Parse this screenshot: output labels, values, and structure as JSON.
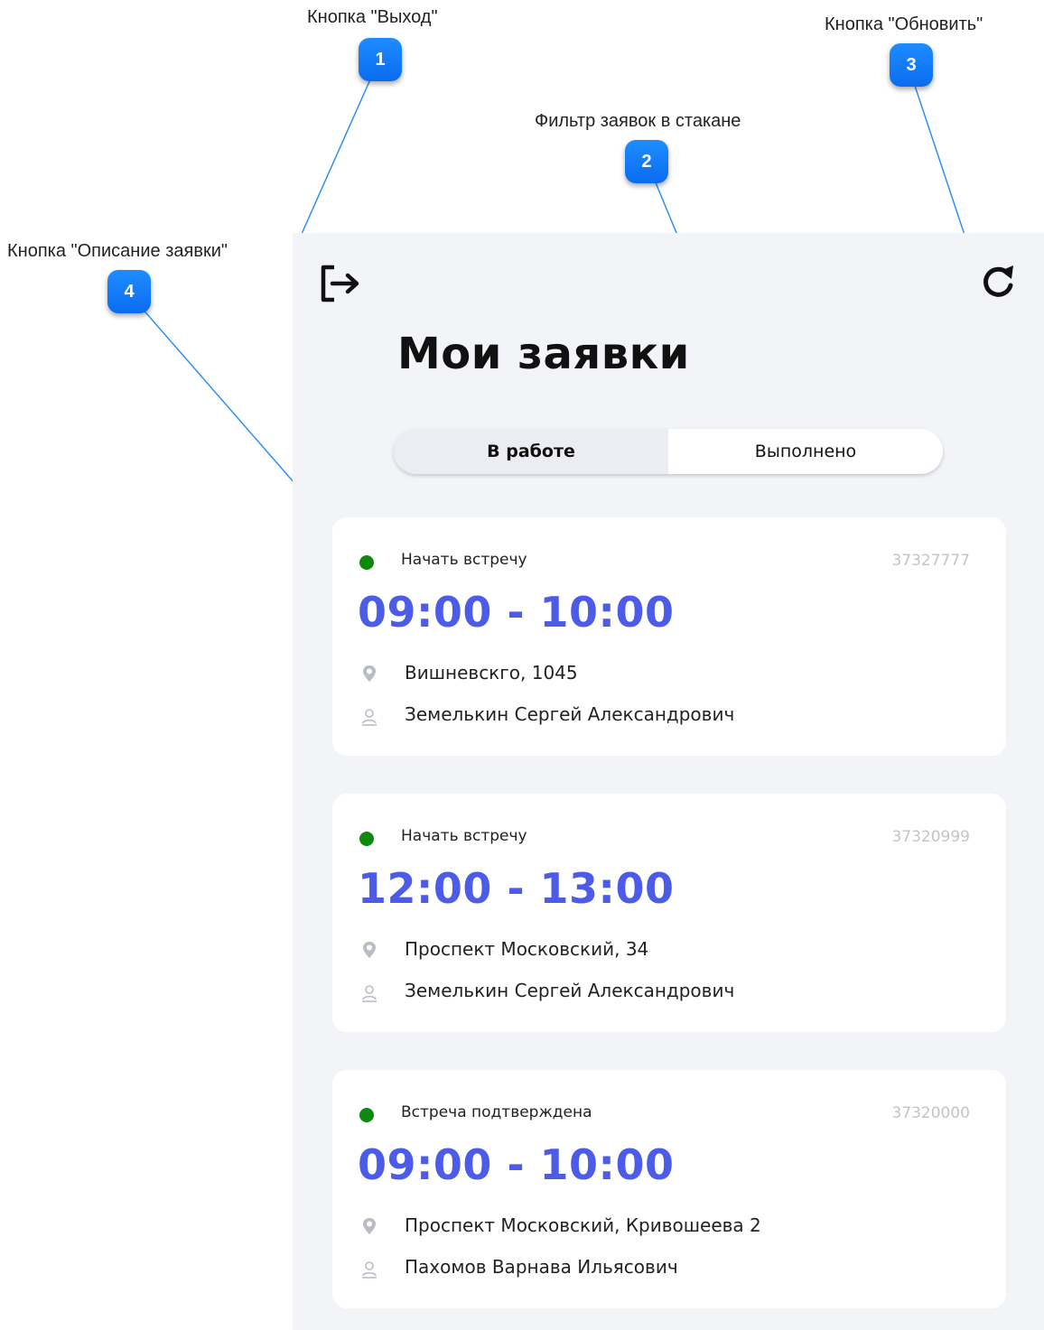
{
  "annotations": [
    {
      "number": "1",
      "label": "Кнопка \"Выход\""
    },
    {
      "number": "2",
      "label": "Фильтр заявок в стакане"
    },
    {
      "number": "3",
      "label": "Кнопка \"Обновить\""
    },
    {
      "number": "4",
      "label": "Кнопка \"Описание заявки\""
    }
  ],
  "header": {
    "exit_icon": "logout-icon",
    "refresh_icon": "refresh-icon",
    "title": "Мои заявки"
  },
  "filter": {
    "tabs": [
      {
        "label": "В работе",
        "active": true
      },
      {
        "label": "Выполнено",
        "active": false
      }
    ]
  },
  "requests": [
    {
      "status": "Начать встречу",
      "status_color": "#0d8a0d",
      "number": "37327777",
      "time": "09:00 - 10:00",
      "address": "Вишневскго, 1045",
      "person": "Земелькин  Сергей  Александрович"
    },
    {
      "status": "Начать встречу",
      "status_color": "#0d8a0d",
      "number": "37320999",
      "time": "12:00 - 13:00",
      "address": "Проспект Московский, 34",
      "person": "Земелькин  Сергей  Александрович"
    },
    {
      "status": "Встреча подтверждена",
      "status_color": "#0d8a0d",
      "number": "37320000",
      "time": "09:00 - 10:00",
      "address": "Проспект Московский, Кривошеева  2",
      "person": "Пахомов Варнава Ильясович"
    }
  ],
  "colors": {
    "accent_time": "#4c5be8",
    "badge": "#0a6cf0",
    "screen_bg": "#f2f4f8"
  }
}
